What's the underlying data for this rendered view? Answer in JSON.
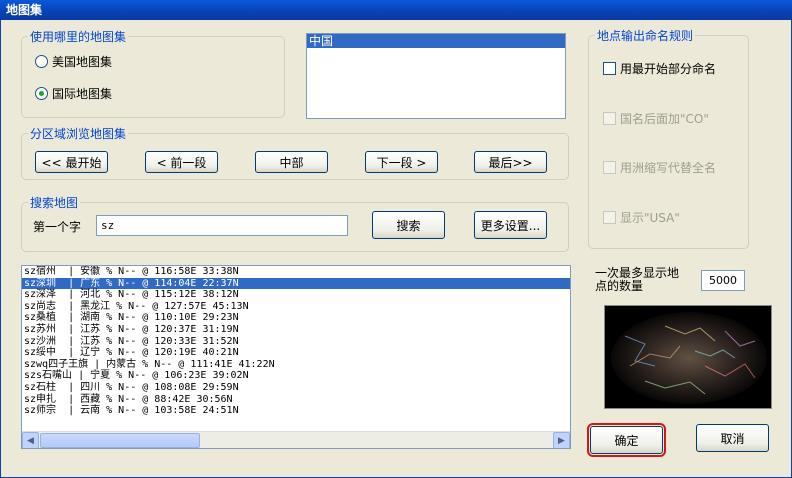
{
  "window": {
    "title": "地图集"
  },
  "atlas_source": {
    "legend": "使用哪里的地图集",
    "options": [
      {
        "label": "美国地图集",
        "selected": false
      },
      {
        "label": "国际地图集",
        "selected": true
      }
    ]
  },
  "country_list": {
    "items": [
      "中国"
    ],
    "selected_index": 0
  },
  "naming_rules": {
    "legend": "地点输出命名规则",
    "options": [
      {
        "label": "用最开始部分命名",
        "checked": false,
        "enabled": true
      },
      {
        "label": "国名后面加\"CO\"",
        "checked": false,
        "enabled": false
      },
      {
        "label": "用洲缩写代替全名",
        "checked": false,
        "enabled": false
      },
      {
        "label": "显示\"USA\"",
        "checked": false,
        "enabled": false
      }
    ]
  },
  "browse": {
    "legend": "分区域浏览地图集",
    "buttons": {
      "first": "<< 最开始",
      "prev": "< 前一段",
      "middle": "中部",
      "next": "下一段 >",
      "last": "最后>>"
    }
  },
  "search": {
    "legend": "搜索地图",
    "first_char_label": "第一个字",
    "value": "sz",
    "search_button": "搜索",
    "more_button": "更多设置..."
  },
  "results": {
    "rows": [
      "sz宿州  | 安徽 % N-- @ 116:58E 33:38N",
      "sz深圳  | 广东 % N-- @ 114:04E 22:37N",
      "sz深泽  | 河北 % N-- @ 115:12E 38:12N",
      "sz尚志  | 黑龙江 % N-- @ 127:57E 45:13N",
      "sz桑植  | 湖南 % N-- @ 110:10E 29:23N",
      "sz苏州  | 江苏 % N-- @ 120:37E 31:19N",
      "sz沙洲  | 江苏 % N-- @ 120:33E 31:52N",
      "sz绥中  | 辽宁 % N-- @ 120:19E 40:21N",
      "szwq四子王旗 | 内蒙古 % N-- @ 111:41E 41:22N",
      "szs石嘴山 | 宁夏 % N-- @ 106:23E 39:02N",
      "sz石柱  | 四川 % N-- @ 108:08E 29:59N",
      "sz申扎  | 西藏 % N-- @ 88:42E 30:56N",
      "sz师宗  | 云南 % N-- @ 103:58E 24:51N"
    ],
    "selected_index": 1
  },
  "max_display": {
    "label": "一次最多显示地点的数量",
    "value": "5000"
  },
  "footer": {
    "ok": "确定",
    "cancel": "取消"
  },
  "icons": {
    "scroll_left": "left-arrow",
    "scroll_right": "right-arrow"
  },
  "colors": {
    "accent": "#0046d5",
    "selection": "#316ac5",
    "titlebar": "#0842b4"
  }
}
